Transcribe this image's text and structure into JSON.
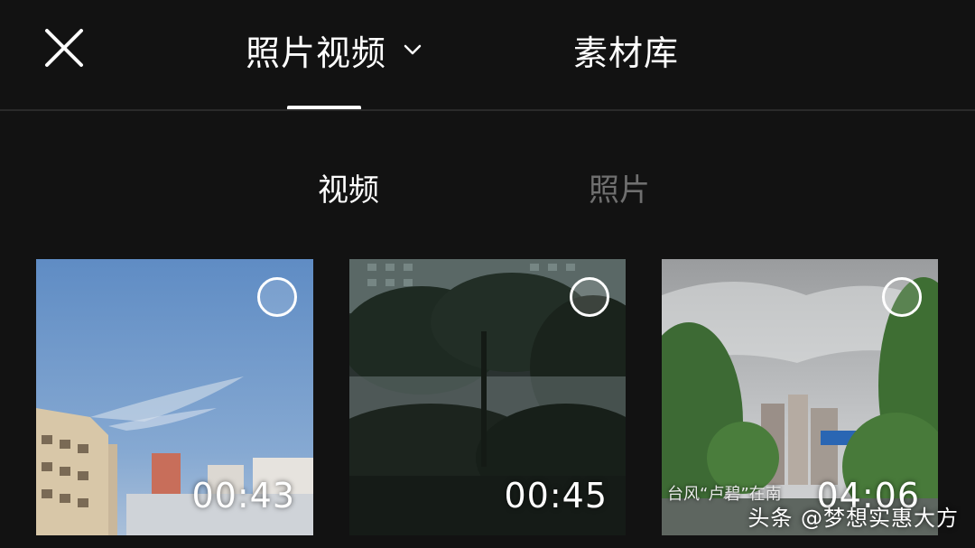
{
  "header": {
    "close_icon": "close-icon",
    "tabs": [
      {
        "label": "照片视频",
        "active": true,
        "has_dropdown": true
      },
      {
        "label": "素材库",
        "active": false
      }
    ]
  },
  "subtabs": [
    {
      "label": "视频",
      "active": true
    },
    {
      "label": "照片",
      "active": false
    }
  ],
  "media": [
    {
      "duration": "00:43",
      "scene": "blue sky with apartment buildings"
    },
    {
      "duration": "00:45",
      "scene": "dark trees at dusk in front of buildings"
    },
    {
      "duration": "04:06",
      "scene": "cloudy sky street with trees and high-rises",
      "caption": "台风“卢碧”在南"
    }
  ],
  "watermark": "头条 @梦想实惠大方",
  "colors": {
    "background": "#121212",
    "active_text": "#ffffff",
    "inactive_text": "#6f6f6f",
    "divider": "#2a2a2a"
  }
}
